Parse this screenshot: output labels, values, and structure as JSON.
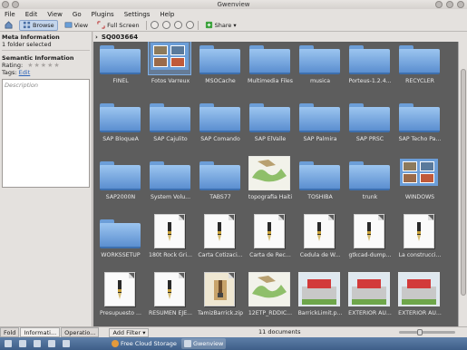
{
  "window": {
    "title": "Gwenview"
  },
  "menu": [
    "File",
    "Edit",
    "View",
    "Go",
    "Plugins",
    "Settings",
    "Help"
  ],
  "toolbar": {
    "browse": "Browse",
    "view": "View",
    "fullscreen": "Full Screen",
    "share": "Share"
  },
  "breadcrumb": {
    "folder": "SQ003664"
  },
  "side": {
    "meta_title": "Meta Information",
    "meta_line": "1 folder selected",
    "semantic_title": "Semantic Information",
    "rating_label": "Rating:",
    "tags_label": "Tags:",
    "tags_edit": "Edit",
    "description_placeholder": "Description"
  },
  "items": [
    {
      "name": "FINEL",
      "kind": "folder"
    },
    {
      "name": "Fotos Varreux",
      "kind": "photos",
      "selected": true
    },
    {
      "name": "MSOCache",
      "kind": "folder"
    },
    {
      "name": "Multimedia Files",
      "kind": "folder"
    },
    {
      "name": "musica",
      "kind": "folder"
    },
    {
      "name": "Porteus-1.2.4...",
      "kind": "folder"
    },
    {
      "name": "RECYCLER",
      "kind": "folder"
    },
    {
      "name": "SAP BloqueA",
      "kind": "folder"
    },
    {
      "name": "SAP Cajulito",
      "kind": "folder"
    },
    {
      "name": "SAP Comando",
      "kind": "folder"
    },
    {
      "name": "SAP ElValle",
      "kind": "folder"
    },
    {
      "name": "SAP Palmira",
      "kind": "folder"
    },
    {
      "name": "SAP PRSC",
      "kind": "folder"
    },
    {
      "name": "SAP Techo Pa...",
      "kind": "folder"
    },
    {
      "name": "SAP2000N",
      "kind": "folder"
    },
    {
      "name": "System Volu...",
      "kind": "folder"
    },
    {
      "name": "TABS77",
      "kind": "folder"
    },
    {
      "name": "topografia Haiti",
      "kind": "map"
    },
    {
      "name": "TOSHIBA",
      "kind": "folder"
    },
    {
      "name": "trunk",
      "kind": "folder"
    },
    {
      "name": "WINDOWS",
      "kind": "photos"
    },
    {
      "name": "WORKSSETUP",
      "kind": "folder"
    },
    {
      "name": "180t Rock Gri...",
      "kind": "doc"
    },
    {
      "name": "Carta Cotizaci...",
      "kind": "doc"
    },
    {
      "name": "Carta de Rec...",
      "kind": "doc"
    },
    {
      "name": "Cedula de W...",
      "kind": "doc"
    },
    {
      "name": "gtkcad-dump...",
      "kind": "doc"
    },
    {
      "name": "La construcci...",
      "kind": "doc"
    },
    {
      "name": "Presupuesto ...",
      "kind": "doc"
    },
    {
      "name": "RESUMEN EJE...",
      "kind": "doc"
    },
    {
      "name": "TamizBarrick.zip",
      "kind": "zip"
    },
    {
      "name": "12ETP_RDDIC...",
      "kind": "map"
    },
    {
      "name": "BarrickLimit.p...",
      "kind": "image"
    },
    {
      "name": "EXTERIOR AU...",
      "kind": "image"
    },
    {
      "name": "EXTERIOR AU...",
      "kind": "image"
    }
  ],
  "status": {
    "tab_folders": "Fold",
    "tab_info": "Informati...",
    "tab_ops": "Operatio...",
    "add_filter": "Add Filter",
    "count": "11 documents"
  },
  "taskbar": {
    "storage": "Free Cloud Storage",
    "app": "Gwenview"
  },
  "colors": {
    "view_bg": "#5d5d5d",
    "folder": "#6c9ed8",
    "selection": "#7fb0e8",
    "taskbar": "#4a6b95"
  }
}
